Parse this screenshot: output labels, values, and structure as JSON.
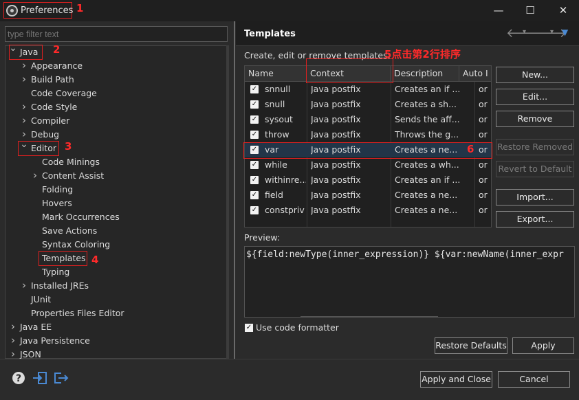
{
  "window": {
    "title": "Preferences",
    "minimize": "—",
    "maximize": "☐",
    "close": "✕"
  },
  "annotations": {
    "n1": "1",
    "n2": "2",
    "n3": "3",
    "n4": "4",
    "n5": "5点击第2行排序",
    "n6": "6"
  },
  "filter": {
    "placeholder": "type filter text"
  },
  "tree": [
    {
      "label": "Java",
      "chevron": "down"
    },
    {
      "label": "Appearance",
      "chevron": "right"
    },
    {
      "label": "Build Path",
      "chevron": "right"
    },
    {
      "label": "Code Coverage",
      "chevron": ""
    },
    {
      "label": "Code Style",
      "chevron": "right"
    },
    {
      "label": "Compiler",
      "chevron": "right"
    },
    {
      "label": "Debug",
      "chevron": "right"
    },
    {
      "label": "Editor",
      "chevron": "down"
    },
    {
      "label": "Code Minings",
      "chevron": ""
    },
    {
      "label": "Content Assist",
      "chevron": "right"
    },
    {
      "label": "Folding",
      "chevron": ""
    },
    {
      "label": "Hovers",
      "chevron": ""
    },
    {
      "label": "Mark Occurrences",
      "chevron": ""
    },
    {
      "label": "Save Actions",
      "chevron": ""
    },
    {
      "label": "Syntax Coloring",
      "chevron": ""
    },
    {
      "label": "Templates",
      "chevron": ""
    },
    {
      "label": "Typing",
      "chevron": ""
    },
    {
      "label": "Installed JREs",
      "chevron": "right"
    },
    {
      "label": "JUnit",
      "chevron": ""
    },
    {
      "label": "Properties Files Editor",
      "chevron": ""
    },
    {
      "label": "Java EE",
      "chevron": "right"
    },
    {
      "label": "Java Persistence",
      "chevron": "right"
    },
    {
      "label": "JSON",
      "chevron": "right"
    }
  ],
  "page": {
    "title": "Templates",
    "description": "Create, edit or remove templates:",
    "columns": [
      "Name",
      "Context",
      "Description",
      "Auto I"
    ],
    "rows": [
      {
        "name": "snnull",
        "context": "Java postfix",
        "description": "Creates an if ...",
        "auto": "or",
        "checked": true
      },
      {
        "name": "snull",
        "context": "Java postfix",
        "description": "Creates a sh...",
        "auto": "or",
        "checked": true
      },
      {
        "name": "sysout",
        "context": "Java postfix",
        "description": "Sends the aff...",
        "auto": "or",
        "checked": true
      },
      {
        "name": "throw",
        "context": "Java postfix",
        "description": "Throws the g...",
        "auto": "or",
        "checked": true
      },
      {
        "name": "var",
        "context": "Java postfix",
        "description": "Creates a ne...",
        "auto": "or",
        "checked": true
      },
      {
        "name": "while",
        "context": "Java postfix",
        "description": "Creates a wh...",
        "auto": "or",
        "checked": true
      },
      {
        "name": "withinre...",
        "context": "Java postfix",
        "description": "Creates an if ...",
        "auto": "or",
        "checked": true
      },
      {
        "name": "field",
        "context": "Java postfix",
        "description": "Creates a ne...",
        "auto": "or",
        "checked": true
      },
      {
        "name": "constpriv",
        "context": "Java postfix",
        "description": "Creates a ne...",
        "auto": "or",
        "checked": true
      }
    ],
    "buttons": {
      "new": "New...",
      "edit": "Edit...",
      "remove": "Remove",
      "restore_removed": "Restore Removed",
      "revert_default": "Revert to Default",
      "import": "Import...",
      "export": "Export..."
    },
    "preview_label": "Preview:",
    "preview_text": "${field:newType(inner_expression)} ${var:newName(inner_expr",
    "use_code_formatter": "Use code formatter",
    "restore_defaults": "Restore Defaults",
    "apply": "Apply"
  },
  "footer": {
    "apply_close": "Apply and Close",
    "cancel": "Cancel"
  }
}
